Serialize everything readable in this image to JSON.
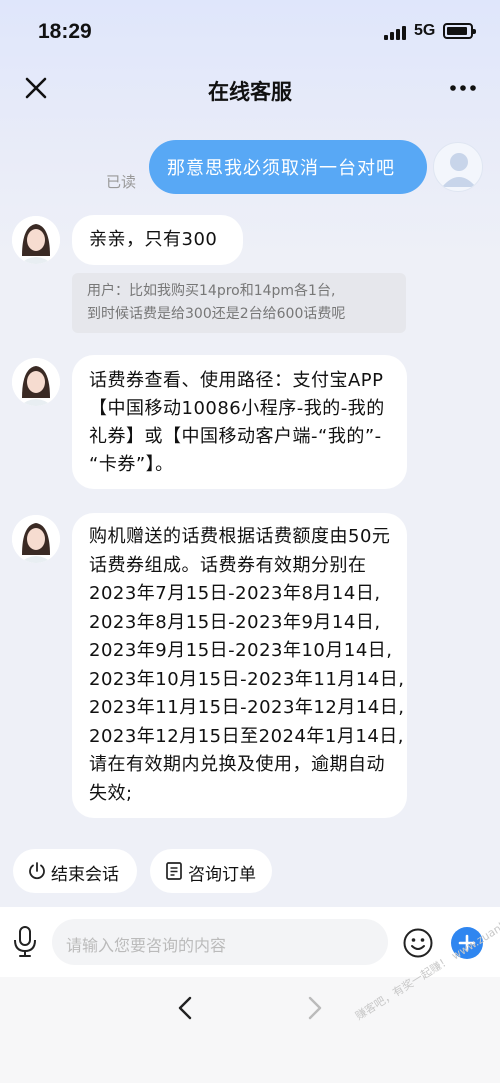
{
  "status_bar": {
    "time": "18:29",
    "network": "5G"
  },
  "nav": {
    "title": "在线客服",
    "close_icon": "close-icon",
    "more_icon": "more-dots-icon"
  },
  "messages": {
    "user_1": {
      "text": "那意思我必须取消一台对吧",
      "read_status": "已读"
    },
    "agent_1": {
      "text": "亲亲，只有300"
    },
    "quote": {
      "lines": [
        "用户：比如我购买14pro和14pm各1台,",
        "到时候话费是给300还是2台给600话费呢"
      ]
    },
    "agent_2": {
      "lines": [
        "话费券查看、使用路径：支付宝APP",
        "【中国移动10086小程序-我的-我的",
        "礼券】或【中国移动客户端-“我的”-",
        "“卡券”】。"
      ]
    },
    "agent_3": {
      "lines": [
        "购机赠送的话费根据话费额度由50元",
        "话费券组成。话费券有效期分别在",
        "2023年7月15日-2023年8月14日,",
        "2023年8月15日-2023年9月14日,",
        "2023年9月15日-2023年10月14日,",
        "2023年10月15日-2023年11月14日,",
        "2023年11月15日-2023年12月14日,",
        "2023年12月15日至2024年1月14日,",
        "请在有效期内兑换及使用，逾期自动",
        "失效;"
      ]
    }
  },
  "quick_actions": {
    "end_chat": "结束会话",
    "order_inquiry": "咨询订单"
  },
  "input": {
    "placeholder": "请输入您要咨询的内容"
  },
  "watermark": "赚客吧，有奖一起赚！ www.zuanke8.com",
  "colors": {
    "user_bubble": "#58a8f5",
    "plus_button": "#2f86f0"
  }
}
